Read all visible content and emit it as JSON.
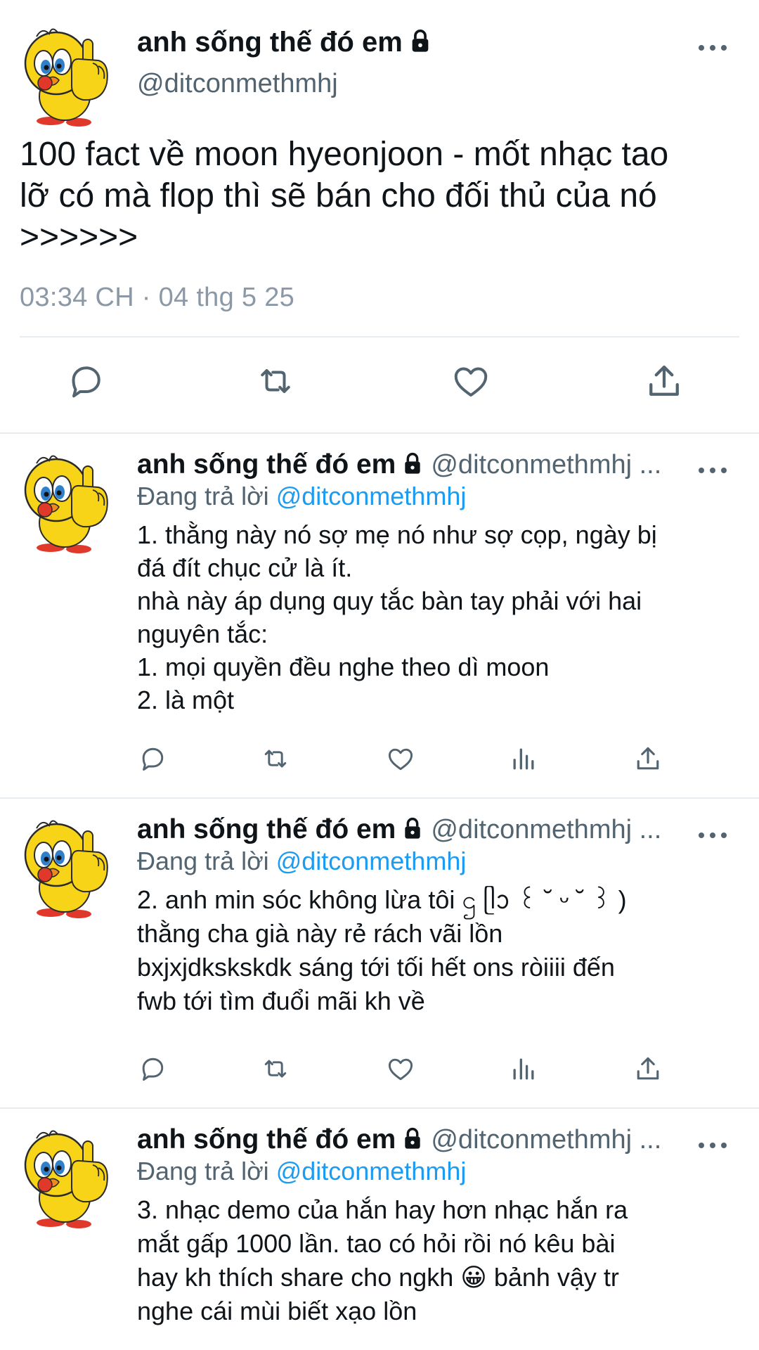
{
  "main_tweet": {
    "author_name": "anh sống thế đó em",
    "author_handle": "@ditconmethmhj",
    "text": "100 fact về moon hyeonjoon - mốt nhạc tao\nlỡ có mà flop thì sẽ bán cho đối thủ của nó\n>>>>>>",
    "timestamp": "03:34 CH · 04 thg 5 25",
    "actions": [
      "reply-icon",
      "retweet-icon",
      "like-icon",
      "share-icon"
    ]
  },
  "replies": [
    {
      "author_name": "anh sống thế đó em",
      "author_handle": "@ditconmethmhj ...",
      "replying_prefix": "Đang trả lời ",
      "replying_to": "@ditconmethmhj",
      "text": "1. thằng này nó sợ mẹ nó như sợ cọp, ngày bị\nđá đít chục cử là ít.\nnhà này áp dụng quy tắc bàn tay phải với hai\nnguyên tắc:\n1. mọi quyền đều nghe theo dì moon\n2. là một"
    },
    {
      "author_name": "anh sống thế đó em",
      "author_handle": "@ditconmethmhj ...",
      "replying_prefix": "Đang trả lời ",
      "replying_to": "@ditconmethmhj",
      "text": "2. anh min sóc không lừa tôi ဌ ᥫᩣ ꒰ ˘ ᵕ ˘ ꒱ )\nthằng cha già này rẻ rách vãi lồn\nbxjxjdkskskdk sáng tới tối hết ons ròiiii đến\nfwb tới tìm đuổi mãi kh về"
    },
    {
      "author_name": "anh sống thế đó em",
      "author_handle": "@ditconmethmhj ...",
      "replying_prefix": "Đang trả lời ",
      "replying_to": "@ditconmethmhj",
      "text": "3. nhạc demo của hắn hay hơn nhạc hắn ra\nmắt gấp 1000 lần. tao có hỏi rồi nó kêu bài\nhay kh thích share cho ngkh 😀  bảnh vậy tr\nnghe cái mùi biết xạo lồn"
    }
  ],
  "reply_actions": [
    "reply-icon",
    "retweet-icon",
    "like-icon",
    "views-icon",
    "share-icon"
  ],
  "colors": {
    "text": "#0f1419",
    "secondary": "#536471",
    "link": "#1d9bf0",
    "icon": "#536471",
    "divider": "#e6ecf0"
  }
}
